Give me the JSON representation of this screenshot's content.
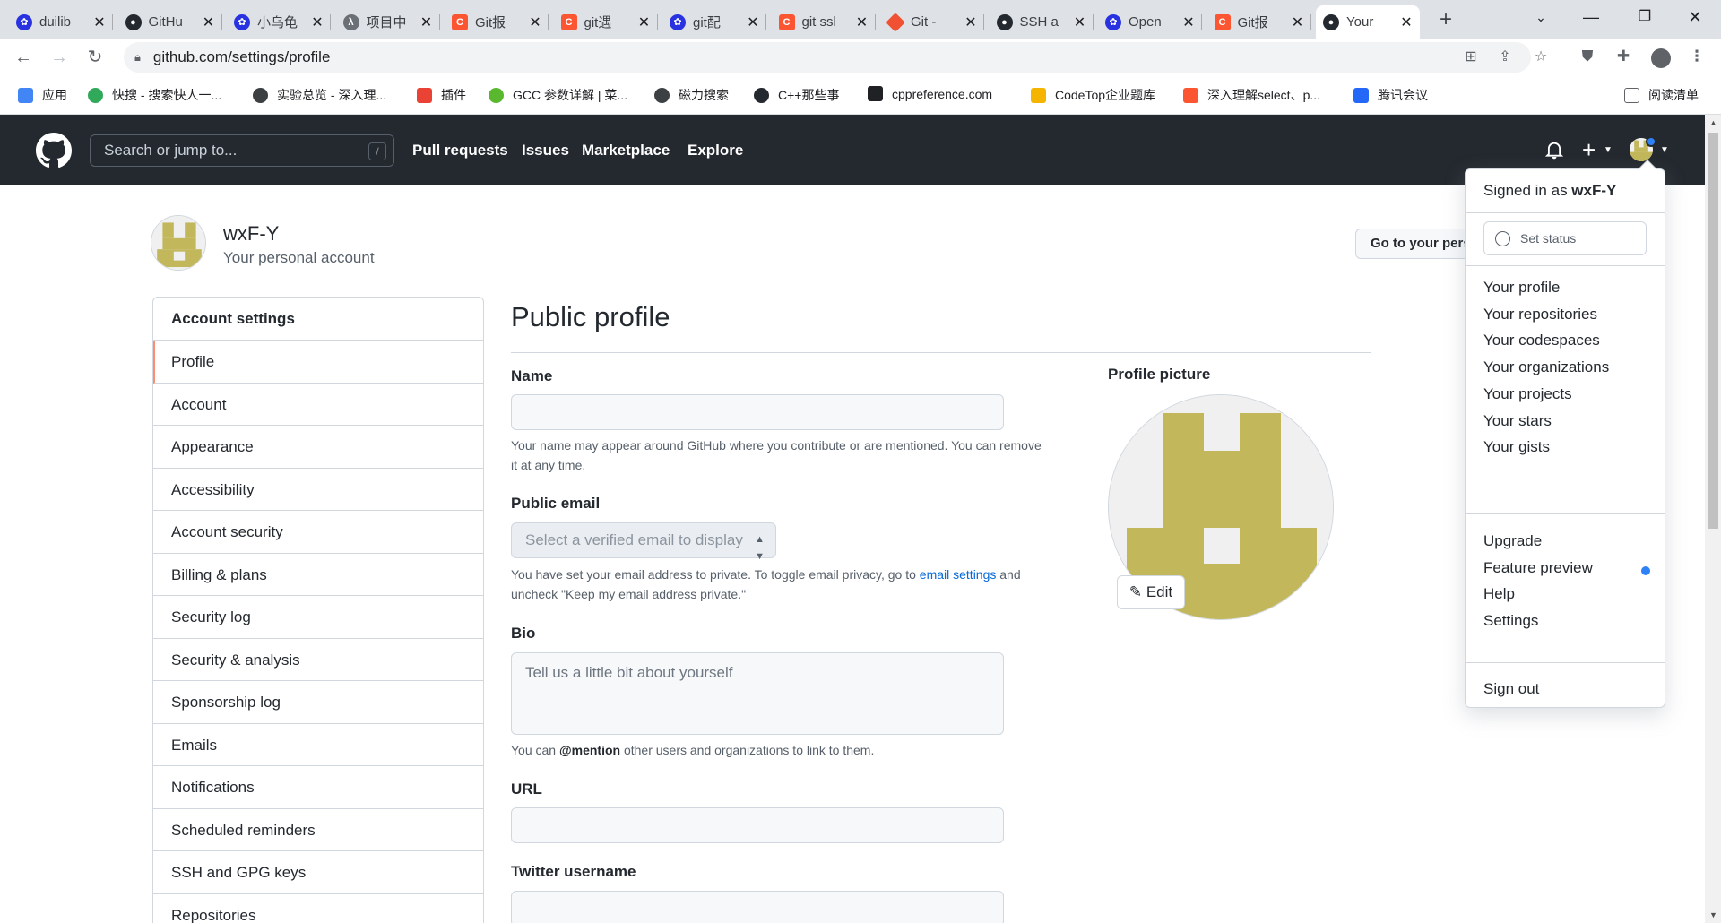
{
  "browser": {
    "tabs": [
      {
        "title": "duilib",
        "icon": "baidu-icon"
      },
      {
        "title": "GitHu",
        "icon": "github-icon"
      },
      {
        "title": "小乌龟",
        "icon": "baidu-icon"
      },
      {
        "title": "项目中",
        "icon": "yuque-icon"
      },
      {
        "title": "Git报",
        "icon": "csdn-icon"
      },
      {
        "title": "git遇",
        "icon": "csdn-icon"
      },
      {
        "title": "git配",
        "icon": "baidu-icon"
      },
      {
        "title": "git ssl",
        "icon": "csdn-icon"
      },
      {
        "title": "Git - ",
        "icon": "git-icon"
      },
      {
        "title": "SSH a",
        "icon": "github-icon"
      },
      {
        "title": "Open",
        "icon": "baidu-icon"
      },
      {
        "title": "Git报",
        "icon": "csdn-icon"
      },
      {
        "title": "Your",
        "icon": "github-icon",
        "active": true
      }
    ],
    "url": "github.com/settings/profile",
    "bookmarks": [
      {
        "label": "应用",
        "icon": "apps-grid-icon"
      },
      {
        "label": "快搜 - 搜索快人一...",
        "icon": "search-engine-icon"
      },
      {
        "label": "实验总览 - 深入理...",
        "icon": "globe-icon"
      },
      {
        "label": "插件",
        "icon": "rainbow-icon"
      },
      {
        "label": "GCC 参数详解 | 菜...",
        "icon": "runoob-icon"
      },
      {
        "label": "磁力搜索",
        "icon": "globe-icon"
      },
      {
        "label": "C++那些事",
        "icon": "github-icon"
      },
      {
        "label": "cppreference.com",
        "icon": "cppreference-icon"
      },
      {
        "label": "CodeTop企业题库",
        "icon": "bar-chart-icon"
      },
      {
        "label": "深入理解select、p...",
        "icon": "csdn-icon"
      },
      {
        "label": "腾讯会议",
        "icon": "tencent-meeting-icon"
      }
    ],
    "reading_list": "阅读清单"
  },
  "header": {
    "search_placeholder": "Search or jump to...",
    "search_shortcut": "/",
    "nav": [
      "Pull requests",
      "Issues",
      "Marketplace",
      "Explore"
    ]
  },
  "user": {
    "name": "wxF-Y",
    "subtitle": "Your personal account",
    "goto_button": "Go to your personal profile"
  },
  "sidebar": {
    "heading": "Account settings",
    "items": [
      "Profile",
      "Account",
      "Appearance",
      "Accessibility",
      "Account security",
      "Billing & plans",
      "Security log",
      "Security & analysis",
      "Sponsorship log",
      "Emails",
      "Notifications",
      "Scheduled reminders",
      "SSH and GPG keys",
      "Repositories"
    ],
    "selected": "Profile"
  },
  "profile": {
    "title": "Public profile",
    "name_label": "Name",
    "name_value": "",
    "name_note": "Your name may appear around GitHub where you contribute or are mentioned. You can remove it at any time.",
    "email_label": "Public email",
    "email_select": "Select a verified email to display",
    "email_note_pre": "You have set your email address to private. To toggle email privacy, go to ",
    "email_note_link": "email settings",
    "email_note_post": " and uncheck \"Keep my email address private.\"",
    "bio_label": "Bio",
    "bio_placeholder": "Tell us a little bit about yourself",
    "bio_note_pre": "You can ",
    "bio_note_mention": "@mention",
    "bio_note_post": " other users and organizations to link to them.",
    "url_label": "URL",
    "twitter_label": "Twitter username",
    "picture_label": "Profile picture",
    "edit_button": "Edit"
  },
  "dropdown": {
    "signed_in_prefix": "Signed in as ",
    "signed_in_user": "wxF-Y",
    "set_status": "Set status",
    "group1": [
      "Your profile",
      "Your repositories",
      "Your codespaces",
      "Your organizations",
      "Your projects",
      "Your stars",
      "Your gists"
    ],
    "group2": [
      "Upgrade",
      "Feature preview",
      "Help",
      "Settings"
    ],
    "sign_out": "Sign out"
  },
  "colors": {
    "header_bg": "#24292f",
    "avatar_fill": "#c2b75a",
    "link": "#0969da",
    "selected_accent": "#fd8c73",
    "notice_dot": "#2f81f7"
  }
}
